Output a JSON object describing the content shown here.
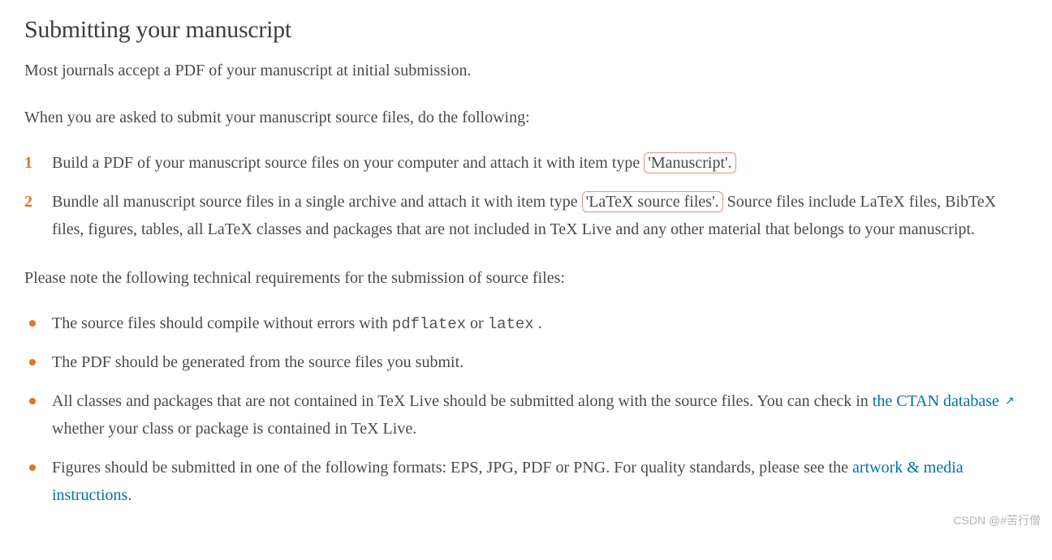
{
  "heading": "Submitting your manuscript",
  "intro": "Most journals accept a PDF of your manuscript at initial submission.",
  "lead1": "When you are asked to submit your manuscript source files, do the following:",
  "ordered": [
    {
      "pre": "Build a PDF of your manuscript source files on your computer and attach it with item type ",
      "highlight": "'Manuscript'.",
      "post": ""
    },
    {
      "pre": "Bundle all manuscript source files in a single archive and attach it with item type ",
      "highlight": "'LaTeX source files'.",
      "post": " Source files include LaTeX files, BibTeX files, figures, tables, all LaTeX classes and packages that are not included in TeX Live and any other material that belongs to your manuscript."
    }
  ],
  "lead2": "Please note the following technical requirements for the submission of source files:",
  "bullets": {
    "b1_pre": "The source files should compile without errors with ",
    "b1_code1": "pdflatex",
    "b1_mid": " or ",
    "b1_code2": "latex",
    "b1_post": " .",
    "b2": "The PDF should be generated from the source files you submit.",
    "b3_pre": "All classes and packages that are not contained in TeX Live should be submitted along with the source files. You can check in ",
    "b3_link": "the CTAN database",
    "b3_post": " whether your class or package is contained in TeX Live.",
    "b4_pre": "Figures should be submitted in one of the following formats: EPS, JPG, PDF or PNG. For quality standards, please see the ",
    "b4_link": "artwork & media instructions",
    "b4_post": "."
  },
  "watermark": "CSDN @#苦行僧"
}
